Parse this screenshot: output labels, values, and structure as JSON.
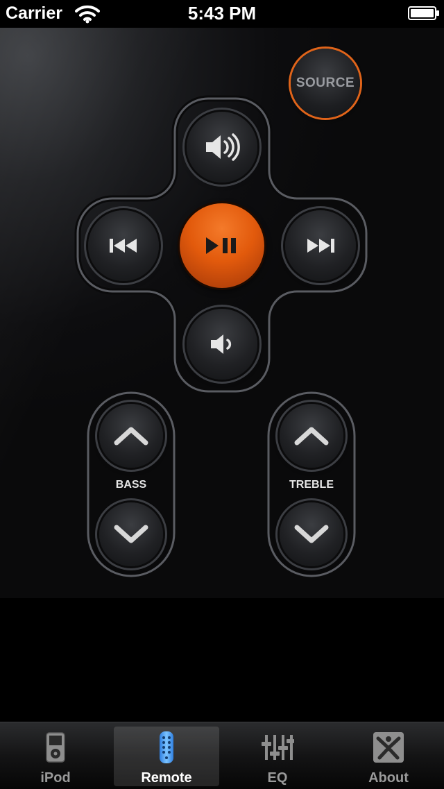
{
  "status_bar": {
    "carrier": "Carrier",
    "time": "5:43 PM"
  },
  "remote": {
    "source_label": "SOURCE",
    "bass_label": "BASS",
    "treble_label": "TREBLE"
  },
  "tabs": [
    {
      "label": "iPod",
      "icon": "ipod-icon",
      "selected": false
    },
    {
      "label": "Remote",
      "icon": "remote-icon",
      "selected": true
    },
    {
      "label": "EQ",
      "icon": "equalizer-icon",
      "selected": false
    },
    {
      "label": "About",
      "icon": "about-icon",
      "selected": false
    }
  ],
  "colors": {
    "accent_orange": "#e25a0c",
    "source_ring": "#e0641a",
    "remote_icon_blue": "#4aa3ff"
  }
}
